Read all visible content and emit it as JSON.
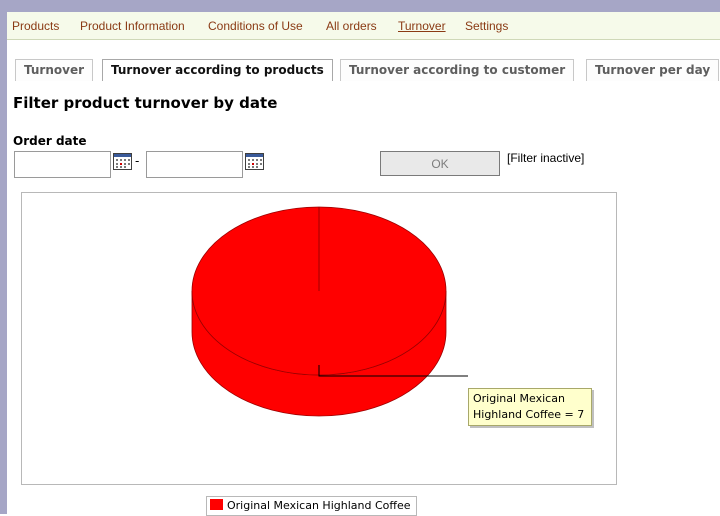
{
  "menu": {
    "items": [
      {
        "label": "Products"
      },
      {
        "label": "Product Information"
      },
      {
        "label": "Conditions of Use"
      },
      {
        "label": "All orders"
      },
      {
        "label": "Turnover"
      },
      {
        "label": "Settings"
      }
    ],
    "active": "Turnover"
  },
  "tabs": [
    {
      "label": "Turnover"
    },
    {
      "label": "Turnover according to products"
    },
    {
      "label": "Turnover according to customer"
    },
    {
      "label": "Turnover per day"
    }
  ],
  "active_tab": "Turnover according to products",
  "heading": "Filter product turnover by date",
  "filter": {
    "order_date_label": "Order date",
    "from_value": "",
    "to_value": "",
    "separator": "-",
    "ok_label": "OK",
    "status": "[Filter inactive]"
  },
  "chart_data": {
    "type": "pie",
    "style": "3d",
    "slices": [
      {
        "label": "Original Mexican Highland Coffee",
        "value": 7,
        "color": "#ff0000"
      }
    ],
    "tooltip": {
      "line1": "Original Mexican",
      "line2": "Highland Coffee = 7"
    },
    "legend_position": "bottom"
  },
  "icons": {
    "calendar": "calendar-icon"
  }
}
